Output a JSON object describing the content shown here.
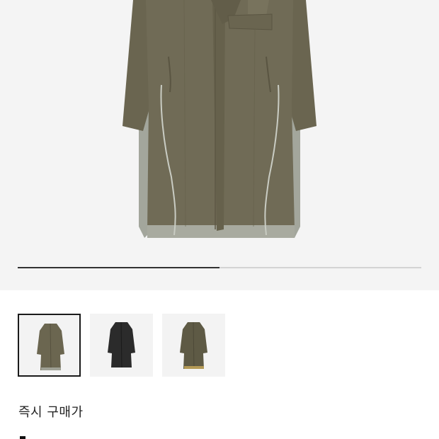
{
  "product": {
    "gallery": {
      "progress_fraction": 0.5,
      "thumbnails": [
        {
          "color": "#6b6650",
          "icon": "olive-coat-thumbnail",
          "selected": true
        },
        {
          "color": "#2b2b2b",
          "icon": "black-coat-thumbnail",
          "selected": false
        },
        {
          "color": "#5e5a45",
          "icon": "olive-coat-alt-thumbnail",
          "selected": false
        }
      ]
    },
    "price_section": {
      "label": "즉시 구매가"
    }
  },
  "colors": {
    "hero_background": "#f4f4f4",
    "coat_body": "#6e6954",
    "coat_panel": "#a5a89e",
    "progress_track": "#d3d3d3",
    "progress_fill": "#333333"
  }
}
